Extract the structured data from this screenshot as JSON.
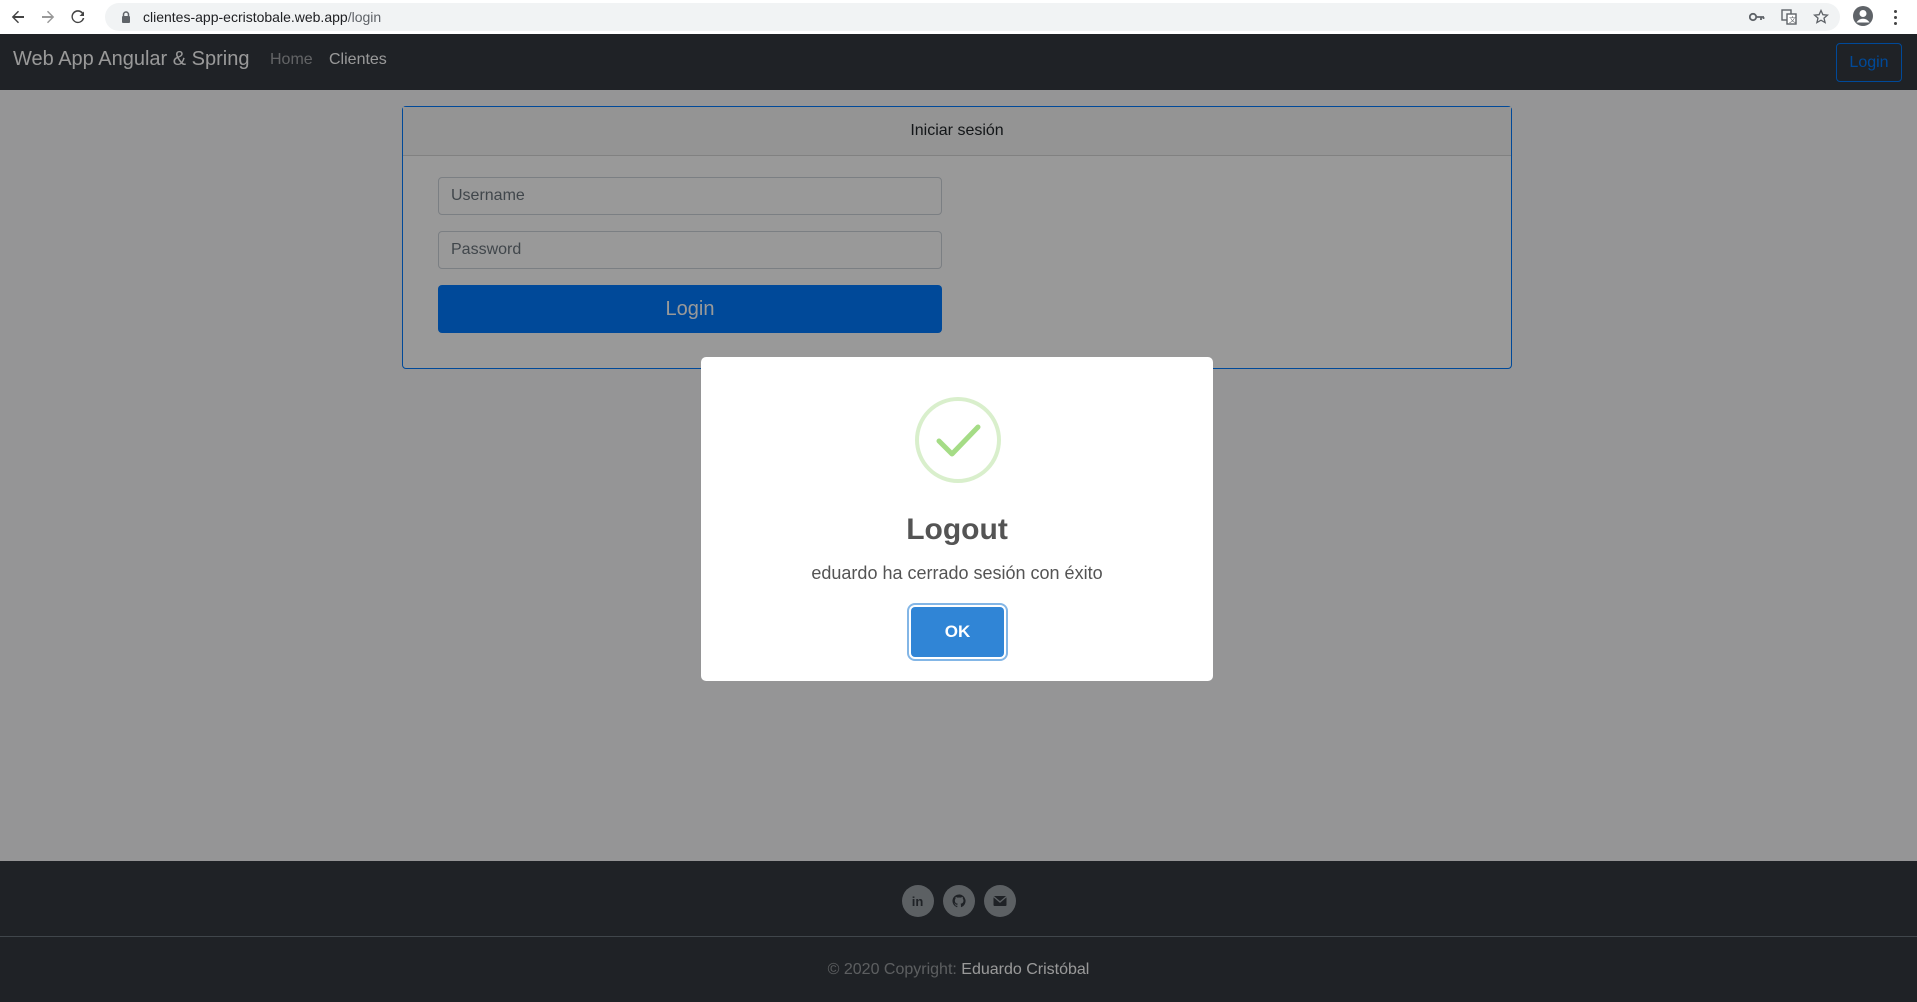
{
  "browser": {
    "url_host": "clientes-app-ecristobale.web.app",
    "url_path": "/login",
    "icons": [
      "back-arrow-icon",
      "forward-arrow-icon",
      "reload-icon",
      "lock-icon",
      "key-icon",
      "translate-icon",
      "star-icon",
      "account-icon",
      "menu-kebab-icon"
    ]
  },
  "navbar": {
    "brand": "Web App Angular & Spring",
    "links": [
      {
        "label": "Home"
      },
      {
        "label": "Clientes"
      }
    ],
    "login_label": "Login"
  },
  "login_card": {
    "header": "Iniciar sesión",
    "username_placeholder": "Username",
    "password_placeholder": "Password",
    "submit_label": "Login"
  },
  "footer": {
    "social_icons": [
      "linkedin-icon",
      "github-icon",
      "email-icon"
    ],
    "copyright_prefix": "© 2020 Copyright: ",
    "author": "Eduardo Cristóbal"
  },
  "modal": {
    "icon": "success-check-icon",
    "title": "Logout",
    "text": "eduardo ha cerrado sesión con éxito",
    "confirm_label": "OK"
  },
  "colors": {
    "navbar_bg": "#343a40",
    "primary": "#007bff",
    "modal_confirm": "#3085d6",
    "success_check": "#a5dc86"
  }
}
